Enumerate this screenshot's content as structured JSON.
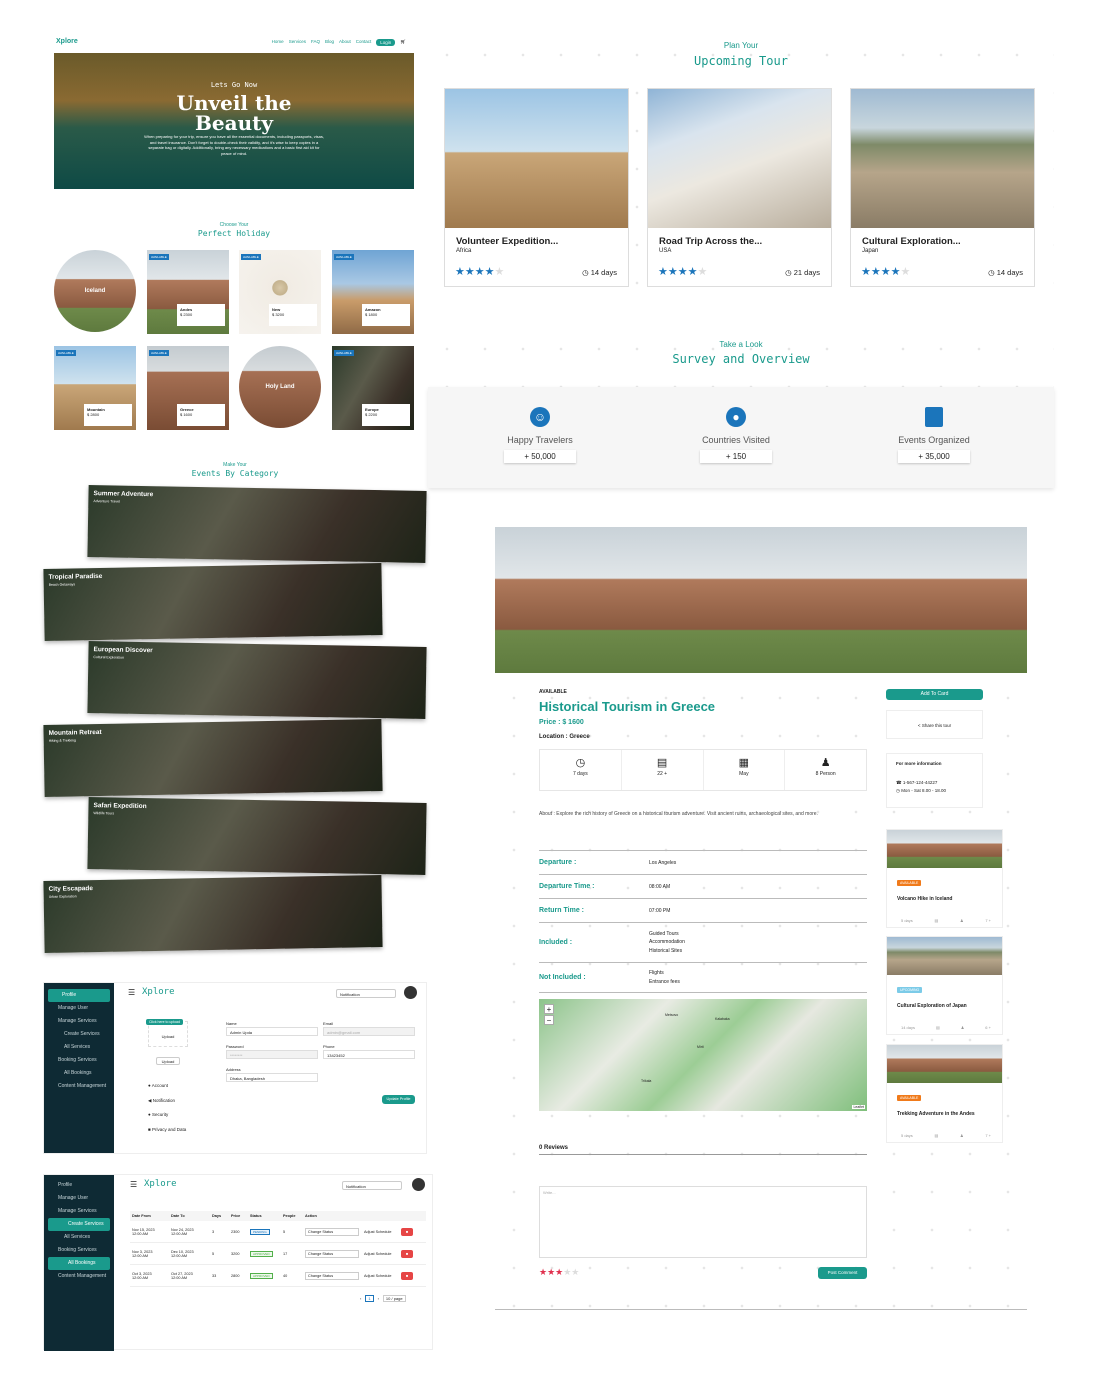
{
  "hero": {
    "logo": "Xplore",
    "nav": [
      "Home",
      "Services",
      "FAQ",
      "Blog",
      "About",
      "Contact"
    ],
    "login": "Login",
    "sub": "Lets Go Now",
    "title1": "Unveil the",
    "title2": "Beauty",
    "desc": "When preparing for your trip, ensure you have all the essential documents, including passports, visas, and travel insurance. Don't forget to double-check their validity, and it's wise to keep copies in a separate bag or digitally. Additionally, bring any necessary medications and a basic first aid kit for peace of mind."
  },
  "holiday": {
    "sub": "Choose Your",
    "title": "Perfect Holiday",
    "badge": "AVAILABLE",
    "items": [
      {
        "name": "Iceland",
        "price": ""
      },
      {
        "name": "Andes",
        "price": "$ 2300"
      },
      {
        "name": "New",
        "price": "$ 3200"
      },
      {
        "name": "Amazon",
        "price": "$ 1800"
      },
      {
        "name": "Mountain",
        "price": "$ 2800"
      },
      {
        "name": "Greece",
        "price": "$ 1600"
      },
      {
        "name": "Holy Land",
        "price": ""
      },
      {
        "name": "Europe",
        "price": "$ 2200"
      }
    ]
  },
  "events": {
    "sub": "Make Your",
    "title": "Events By Category",
    "items": [
      {
        "title": "Summer Adventure",
        "sub": "Adventure Travel"
      },
      {
        "title": "Tropical Paradise",
        "sub": "Beach Getaways"
      },
      {
        "title": "European Discover",
        "sub": "Cultural Exploration"
      },
      {
        "title": "Mountain Retreat",
        "sub": "Hiking & Trekking"
      },
      {
        "title": "Safari Expedition",
        "sub": "Wildlife Tours"
      },
      {
        "title": "City Escapade",
        "sub": "Urban Exploration"
      }
    ]
  },
  "tours": {
    "sub": "Plan Your",
    "title": "Upcoming Tour",
    "items": [
      {
        "title": "Volunteer Expedition...",
        "loc": "Africa",
        "days": "14 days"
      },
      {
        "title": "Road Trip Across the...",
        "loc": "USA",
        "days": "21 days"
      },
      {
        "title": "Cultural Exploration...",
        "loc": "Japan",
        "days": "14 days"
      }
    ]
  },
  "survey": {
    "sub": "Take a Look",
    "title": "Survey and Overview",
    "items": [
      {
        "label": "Happy Travelers",
        "value": "+ 50,000"
      },
      {
        "label": "Countries Visited",
        "value": "+ 150"
      },
      {
        "label": "Events Organized",
        "value": "+ 35,000"
      }
    ]
  },
  "detail": {
    "badge": "AVAILABLE",
    "title": "Historical Tourism in Greece",
    "price": "Price : $ 1600",
    "location": "Location : Greece",
    "facts": [
      "7 days",
      "22 +",
      "May",
      "8 Person"
    ],
    "about": "About : Explore the rich history of Greece on a historical tourism adventure. Visit ancient ruins, archaeological sites, and more.",
    "rows": [
      {
        "k": "Departure :",
        "v": "Los Angeles"
      },
      {
        "k": "Departure Time :",
        "v": "08:00 AM"
      },
      {
        "k": "Return Time :",
        "v": "07:00 PM"
      },
      {
        "k": "Included :",
        "v": "Guided Tours\nAccommodation\nHistorical Sites"
      },
      {
        "k": "Not Included :",
        "v": "Flights\nEntrance fees"
      }
    ],
    "add_card": "Add To Card",
    "share": "Share this tour",
    "info_title": "For more information",
    "phone": "1-567-124-44227",
    "hours": "Mon - Sat 8.00 - 18.00",
    "map_labels": [
      "Leaflet",
      "Metsovo",
      "Kalabaka",
      "Mirti",
      "Trikala"
    ],
    "reviews": "0 Reviews",
    "placeholder": "Write...",
    "post": "Post Comment",
    "related": [
      {
        "badge": "AVAILABLE",
        "title": "Volcano Hike in Iceland",
        "days": "5 days",
        "people": "7 +"
      },
      {
        "badge": "UPCOMING",
        "title": "Cultural Exploration of Japan",
        "days": "14 days",
        "people": "6 +"
      },
      {
        "badge": "AVAILABLE",
        "title": "Trekking Adventure in the Andes",
        "days": "5 days",
        "people": "7 +"
      }
    ]
  },
  "admin1": {
    "logo": "Xplore",
    "notification": "Notification",
    "side": [
      "Profile",
      "Manage User",
      "Manage Services",
      "Create Services",
      "All Services",
      "Booking Services",
      "All Bookings",
      "Content Management"
    ],
    "upload_hint": "Click here to upload",
    "upload_label": "Upload",
    "upload_btn": "Upload",
    "menu": [
      "Account",
      "Notification",
      "Security",
      "Privacy and Data"
    ],
    "fields": {
      "name_label": "Name",
      "name": "Admin Upda",
      "email_label": "Email",
      "email": "admin@gmail.com",
      "password_label": "Password",
      "password": "********",
      "phone_label": "Phone",
      "phone": "13423452",
      "address_label": "Address",
      "address": "Dhaka, Bangladesh"
    },
    "update": "Update Profile"
  },
  "admin2": {
    "logo": "Xplore",
    "notification": "Notification",
    "side": [
      "Profile",
      "Manage User",
      "Manage Services",
      "Create Services",
      "All Services",
      "Booking Services",
      "All Bookings",
      "Content Management"
    ],
    "cols": [
      "Date From",
      "Date To",
      "Days",
      "Price",
      "Status",
      "People",
      "Action"
    ],
    "rows": [
      {
        "from": "Nov 15, 2023\n12:00 AM",
        "to": "Nov 24, 2023\n12:00 AM",
        "days": "3",
        "price": "2300",
        "status": "PENDING",
        "people": "5"
      },
      {
        "from": "Nov 3, 2023\n12:00 AM",
        "to": "Dec 10, 2023\n12:00 AM",
        "days": "5",
        "price": "3200",
        "status": "APPROVED",
        "people": "17"
      },
      {
        "from": "Oct 3, 2023\n12:00 AM",
        "to": "Oct 27, 2023\n12:00 AM",
        "days": "33",
        "price": "2800",
        "status": "APPROVED",
        "people": "40"
      }
    ],
    "change": "Change Status",
    "adjust": "Adjust Schedule",
    "page": "1",
    "per_page": "10 / page"
  }
}
